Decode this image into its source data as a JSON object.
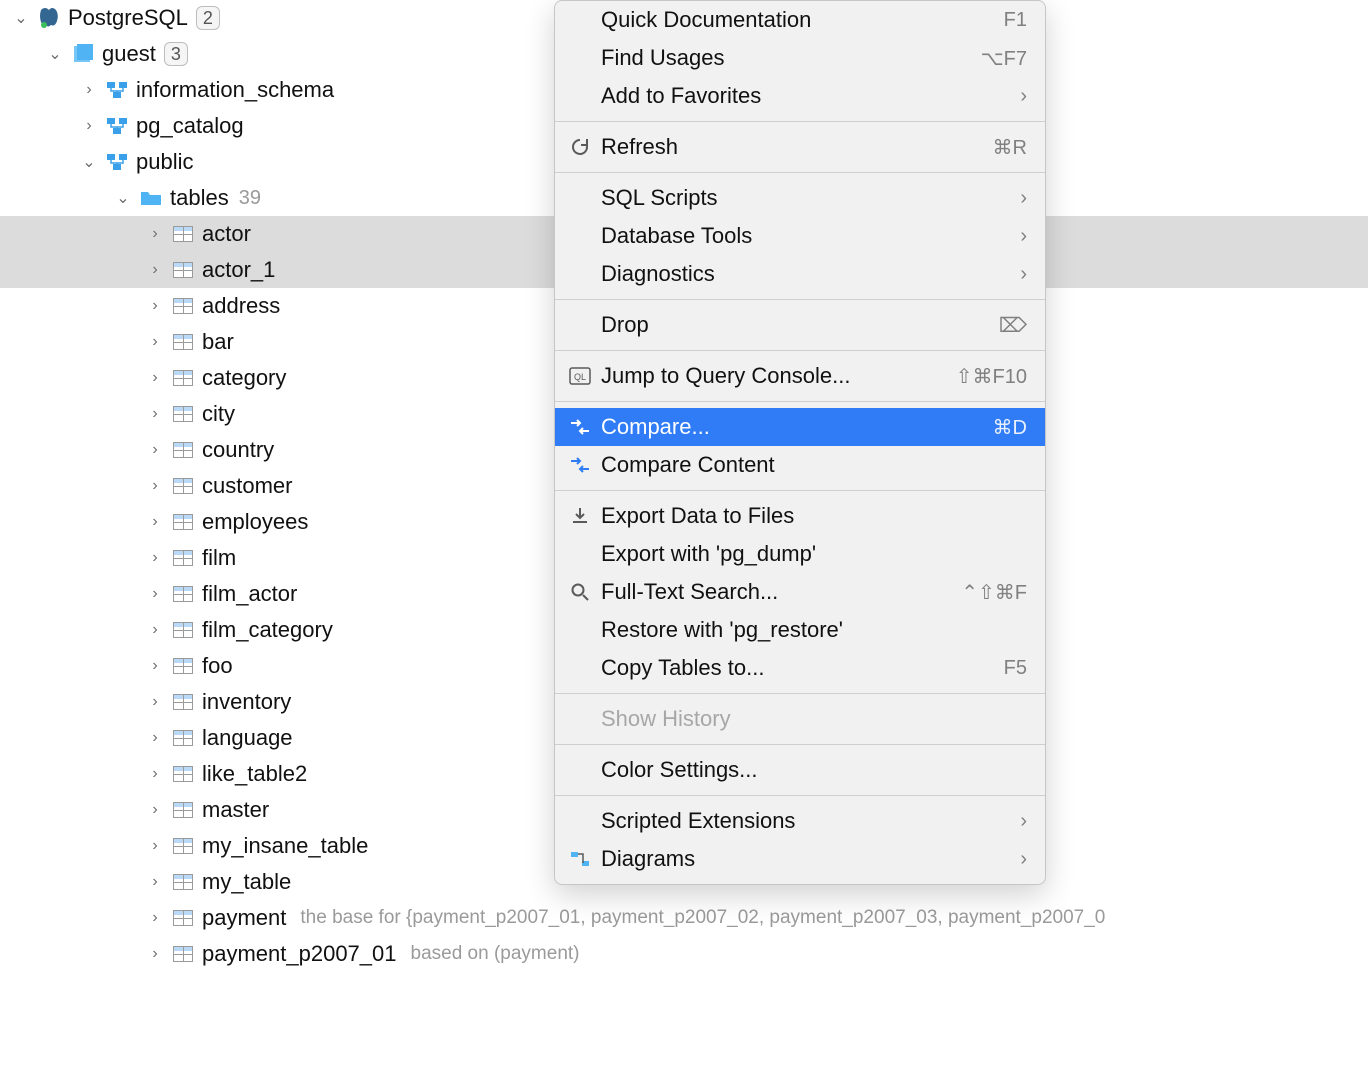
{
  "tree": {
    "root": {
      "label": "PostgreSQL",
      "badge": "2"
    },
    "guest": {
      "label": "guest",
      "badge": "3"
    },
    "schemas": [
      {
        "label": "information_schema"
      },
      {
        "label": "pg_catalog"
      },
      {
        "label": "public"
      }
    ],
    "tables_header": {
      "label": "tables",
      "count": "39"
    },
    "tables": [
      {
        "label": "actor",
        "selected": true
      },
      {
        "label": "actor_1",
        "selected": true
      },
      {
        "label": "address"
      },
      {
        "label": "bar"
      },
      {
        "label": "category"
      },
      {
        "label": "city"
      },
      {
        "label": "country"
      },
      {
        "label": "customer"
      },
      {
        "label": "employees"
      },
      {
        "label": "film"
      },
      {
        "label": "film_actor"
      },
      {
        "label": "film_category"
      },
      {
        "label": "foo"
      },
      {
        "label": "inventory"
      },
      {
        "label": "language"
      },
      {
        "label": "like_table2"
      },
      {
        "label": "master"
      },
      {
        "label": "my_insane_table"
      },
      {
        "label": "my_table"
      },
      {
        "label": "payment",
        "suffix": "the base for {payment_p2007_01, payment_p2007_02, payment_p2007_03, payment_p2007_0"
      },
      {
        "label": "payment_p2007_01",
        "suffix": "based on (payment)"
      }
    ]
  },
  "menu": {
    "groups": [
      [
        {
          "label": "Quick Documentation",
          "shortcut": "F1"
        },
        {
          "label": "Find Usages",
          "shortcut": "⌥F7"
        },
        {
          "label": "Add to Favorites",
          "submenu": true
        }
      ],
      [
        {
          "label": "Refresh",
          "icon": "refresh",
          "shortcut": "⌘R"
        }
      ],
      [
        {
          "label": "SQL Scripts",
          "submenu": true
        },
        {
          "label": "Database Tools",
          "submenu": true
        },
        {
          "label": "Diagnostics",
          "submenu": true
        }
      ],
      [
        {
          "label": "Drop",
          "shortcut": "⌦"
        }
      ],
      [
        {
          "label": "Jump to Query Console...",
          "icon": "console",
          "shortcut": "⇧⌘F10"
        }
      ],
      [
        {
          "label": "Compare...",
          "icon": "compare",
          "shortcut": "⌘D",
          "highlight": true
        },
        {
          "label": "Compare Content",
          "icon": "compare"
        }
      ],
      [
        {
          "label": "Export Data to Files",
          "icon": "export"
        },
        {
          "label": "Export with 'pg_dump'"
        },
        {
          "label": "Full-Text Search...",
          "icon": "search",
          "shortcut": "⌃⇧⌘F"
        },
        {
          "label": "Restore with 'pg_restore'"
        },
        {
          "label": "Copy Tables to...",
          "shortcut": "F5"
        }
      ],
      [
        {
          "label": "Show History",
          "disabled": true
        }
      ],
      [
        {
          "label": "Color Settings..."
        }
      ],
      [
        {
          "label": "Scripted Extensions",
          "submenu": true
        },
        {
          "label": "Diagrams",
          "icon": "diagram",
          "submenu": true
        }
      ]
    ]
  }
}
